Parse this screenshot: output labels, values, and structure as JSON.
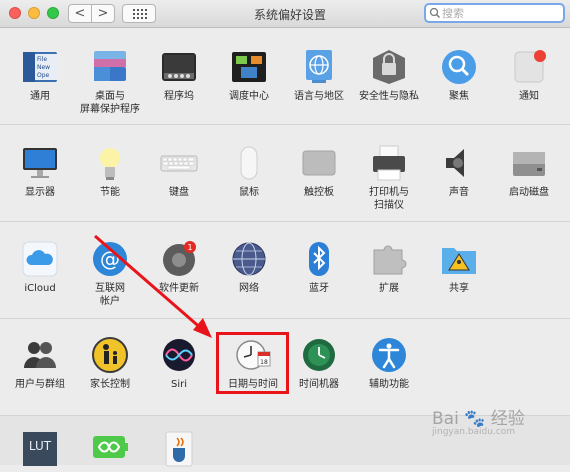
{
  "window": {
    "title": "系统偏好设置"
  },
  "nav": {
    "back": "<",
    "forward": ">"
  },
  "search": {
    "placeholder": "搜索",
    "value": ""
  },
  "rows": [
    [
      {
        "id": "general",
        "label": "通用",
        "icon": "general-icon"
      },
      {
        "id": "desktop",
        "label": "桌面与\n屏幕保护程序",
        "icon": "desktop-screensaver-icon"
      },
      {
        "id": "dock",
        "label": "程序坞",
        "icon": "dock-icon"
      },
      {
        "id": "mission",
        "label": "调度中心",
        "icon": "mission-control-icon"
      },
      {
        "id": "language",
        "label": "语言与地区",
        "icon": "language-region-icon"
      },
      {
        "id": "security",
        "label": "安全性与隐私",
        "icon": "security-privacy-icon"
      },
      {
        "id": "spotlight",
        "label": "聚焦",
        "icon": "spotlight-icon"
      },
      {
        "id": "notifications",
        "label": "通知",
        "icon": "notifications-icon"
      }
    ],
    [
      {
        "id": "displays",
        "label": "显示器",
        "icon": "displays-icon"
      },
      {
        "id": "energy",
        "label": "节能",
        "icon": "energy-saver-icon"
      },
      {
        "id": "keyboard",
        "label": "键盘",
        "icon": "keyboard-icon"
      },
      {
        "id": "mouse",
        "label": "鼠标",
        "icon": "mouse-icon"
      },
      {
        "id": "trackpad",
        "label": "触控板",
        "icon": "trackpad-icon"
      },
      {
        "id": "printers",
        "label": "打印机与\n扫描仪",
        "icon": "printers-scanners-icon"
      },
      {
        "id": "sound",
        "label": "声音",
        "icon": "sound-icon"
      },
      {
        "id": "startup",
        "label": "启动磁盘",
        "icon": "startup-disk-icon"
      }
    ],
    [
      {
        "id": "icloud",
        "label": "iCloud",
        "icon": "icloud-icon"
      },
      {
        "id": "internet",
        "label": "互联网\n帐户",
        "icon": "internet-accounts-icon"
      },
      {
        "id": "update",
        "label": "软件更新",
        "icon": "software-update-icon",
        "badge": "1"
      },
      {
        "id": "network",
        "label": "网络",
        "icon": "network-icon"
      },
      {
        "id": "bluetooth",
        "label": "蓝牙",
        "icon": "bluetooth-icon"
      },
      {
        "id": "extensions",
        "label": "扩展",
        "icon": "extensions-icon"
      },
      {
        "id": "sharing",
        "label": "共享",
        "icon": "sharing-icon"
      }
    ],
    [
      {
        "id": "users",
        "label": "用户与群组",
        "icon": "users-groups-icon"
      },
      {
        "id": "parental",
        "label": "家长控制",
        "icon": "parental-controls-icon"
      },
      {
        "id": "siri",
        "label": "Siri",
        "icon": "siri-icon"
      },
      {
        "id": "datetime",
        "label": "日期与时间",
        "icon": "date-time-icon",
        "calendar_day": "18"
      },
      {
        "id": "timemachine",
        "label": "时间机器",
        "icon": "time-machine-icon"
      },
      {
        "id": "accessibility",
        "label": "辅助功能",
        "icon": "accessibility-icon"
      }
    ],
    [
      {
        "id": "lut",
        "label": "",
        "icon": "lut-icon",
        "icon_text": "LUT"
      },
      {
        "id": "battery",
        "label": "",
        "icon": "battery-infinity-icon"
      },
      {
        "id": "java",
        "label": "",
        "icon": "java-icon"
      }
    ]
  ],
  "general_icon_text": [
    "File",
    "New",
    "Ope"
  ],
  "watermark": {
    "brand": "Bai",
    "suffix": "经验",
    "url": "jingyan.baidu.com"
  },
  "colors": {
    "highlight": "#e8141a",
    "arrow": "#e8141a"
  }
}
